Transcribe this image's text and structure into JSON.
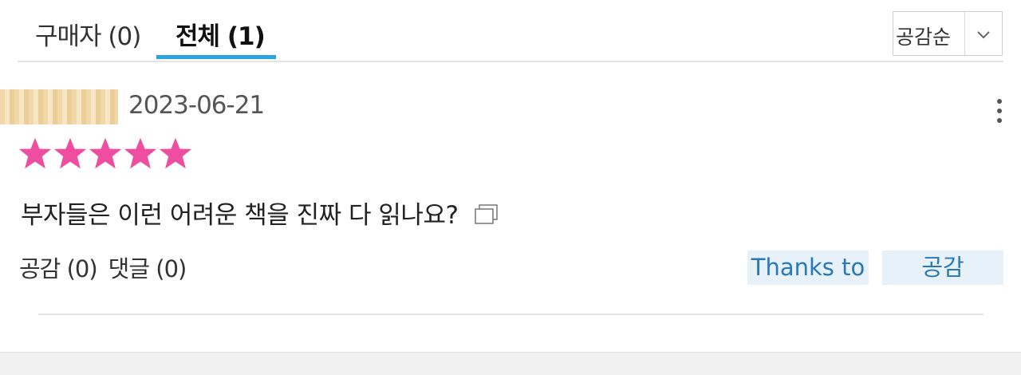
{
  "tabs": {
    "buyer_label": "구매자 (0)",
    "all_label": "전체 (1)"
  },
  "sort": {
    "selected": "공감순",
    "chevron_icon": "chevron-down-icon"
  },
  "review": {
    "date": "2023-06-21",
    "rating": 5,
    "rating_max": 5,
    "star_color": "#ee4da0",
    "text": "부자들은 이런 어려운 책을 진짜 다 읽나요?",
    "like_count_label": "공감 (0)",
    "comment_count_label": "댓글 (0)",
    "thanks_button": "Thanks to",
    "like_button": "공감"
  },
  "colors": {
    "accent": "#2aa3e0",
    "button_bg": "#e6f1f9",
    "button_text": "#2a78b8"
  }
}
